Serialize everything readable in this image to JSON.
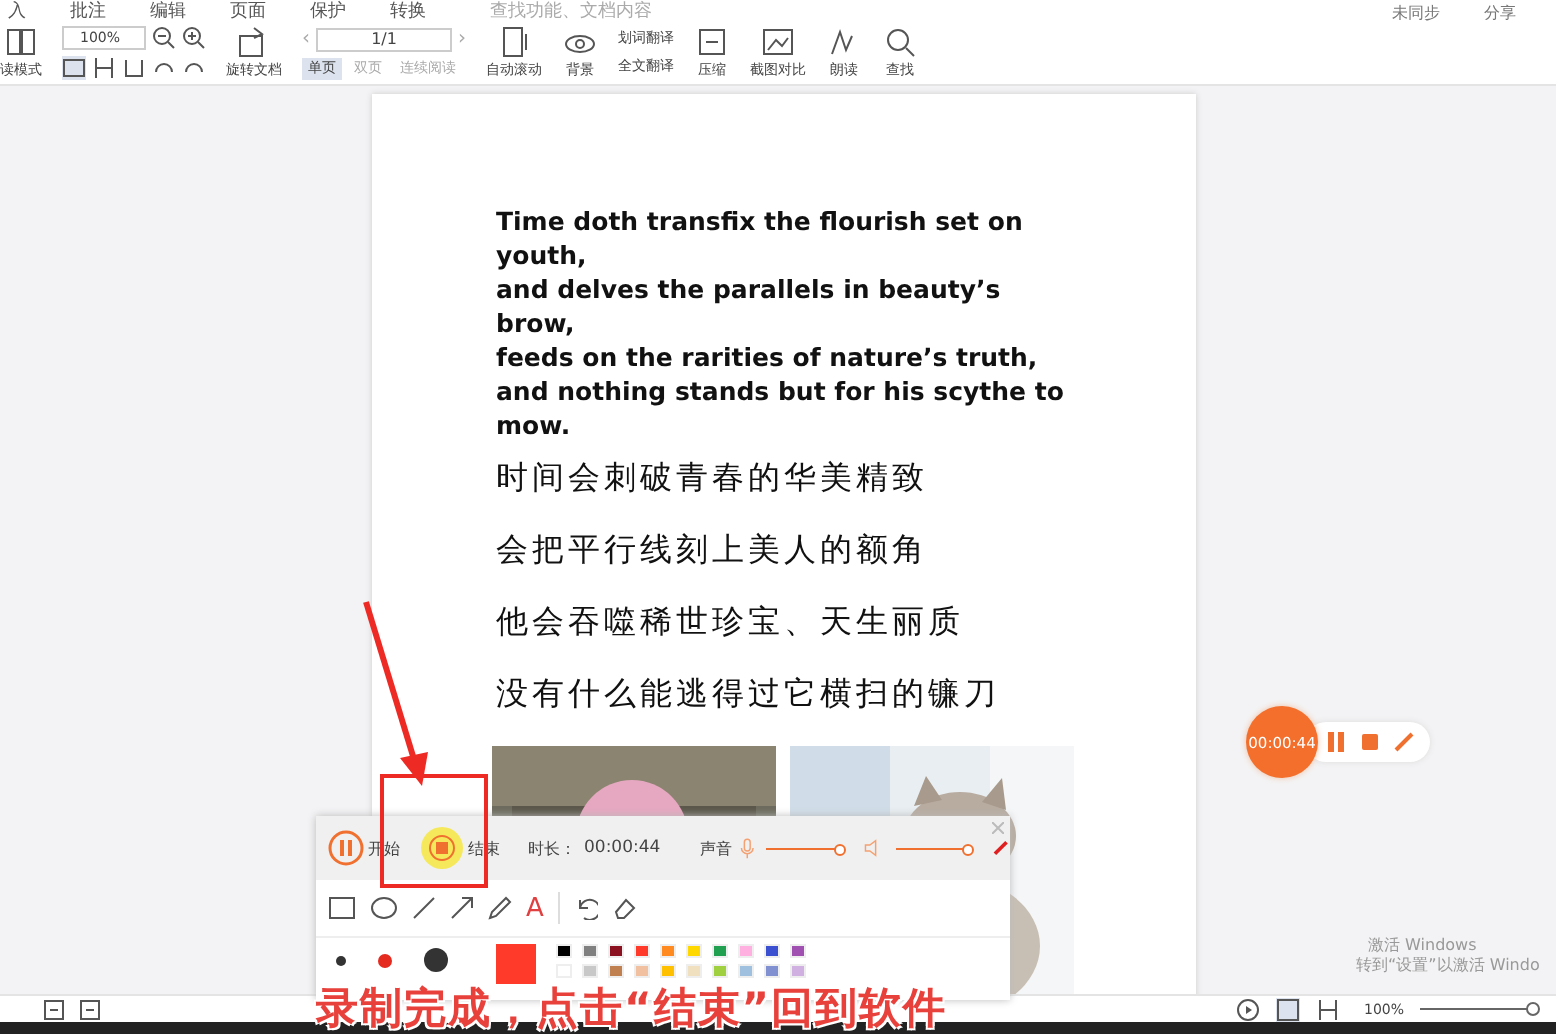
{
  "menu": [
    {
      "label": "入",
      "selected": false
    },
    {
      "label": "批注",
      "selected": false
    },
    {
      "label": "编辑",
      "selected": false
    },
    {
      "label": "页面",
      "selected": false
    },
    {
      "label": "保护",
      "selected": false
    },
    {
      "label": "转换",
      "selected": false
    }
  ],
  "search": {
    "placeholder": "查找功能、文档内容"
  },
  "account": [
    "未同步",
    "分享"
  ],
  "toolbar": {
    "read_mode": "读模式",
    "zoom": "100%",
    "rotate": "旋转文档",
    "page": "1/1",
    "prev": "‹",
    "next": "›",
    "single": {
      "label": "单页",
      "selected": true
    },
    "double": {
      "label": "双页",
      "selected": false
    },
    "continuous": "连续阅读",
    "autoscroll": "自动滚动",
    "background": "背景",
    "translate": "划词翻译",
    "fulltranslate": "全文翻译",
    "compress": "压缩",
    "compare": "截图对比",
    "read_aloud": "朗读",
    "find": "查找"
  },
  "document": {
    "english": [
      "Time doth transfix the flourish set on youth,",
      "and delves the parallels in beauty’s brow,",
      "feeds on the rarities of nature’s truth,",
      "and nothing stands but for his scythe to mow."
    ],
    "chinese": [
      "时间会刺破青春的华美精致",
      "会把平行线刻上美人的额角",
      "他会吞噬稀世珍宝、天生丽质",
      "没有什么能逃得过它横扫的镰刀"
    ]
  },
  "recorder": {
    "start": "开始",
    "end": "结束",
    "duration_label": "时长：",
    "duration": "00:00:44",
    "sound_label": "声音",
    "mic": {
      "level": 1
    },
    "speaker": {
      "level": 1
    },
    "pen_sizes": [
      {
        "selected": false
      },
      {
        "selected": true
      },
      {
        "selected": false
      }
    ],
    "text_tool": "A",
    "colors": [
      {
        "color": "#000000"
      },
      {
        "color": "#808080"
      },
      {
        "color": "#8b1020"
      },
      {
        "color": "#ff3a2a",
        "selected": true
      },
      {
        "color": "#ff8a20"
      },
      {
        "color": "#ffd800"
      },
      {
        "color": "#20a050"
      },
      {
        "color": "#ffb0e0"
      },
      {
        "color": "#3a50d0"
      },
      {
        "color": "#a050b0"
      },
      {
        "color": "#ffffff"
      },
      {
        "color": "#c8c8c8"
      },
      {
        "color": "#c08050"
      },
      {
        "color": "#f0c0a0"
      },
      {
        "color": "#ffc000"
      },
      {
        "color": "#f0e0c0"
      },
      {
        "color": "#a0d040"
      },
      {
        "color": "#a0c0e0"
      },
      {
        "color": "#8090d0"
      },
      {
        "color": "#d0b0e0"
      }
    ]
  },
  "floating_timer": {
    "time": "00:00:44"
  },
  "status_bar": {
    "zoom": "100%",
    "zoom_slider": {
      "level": 1
    }
  },
  "windows_notice": [
    "激活 Windows",
    "转到“设置”以激活 Windo"
  ],
  "caption": "录制完成，点击“结束”回到软件"
}
